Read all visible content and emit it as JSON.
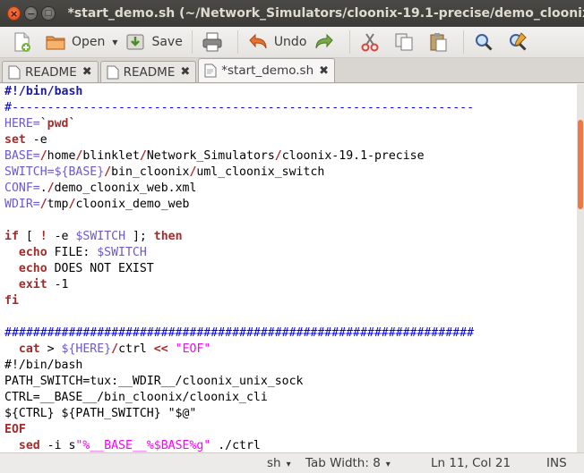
{
  "window": {
    "title": "*start_demo.sh (~/Network_Simulators/cloonix-19.1-precise/demo_cloonix_we",
    "close_glyph": "×",
    "min_glyph": "−",
    "max_glyph": "□"
  },
  "toolbar": {
    "open_label": "Open",
    "save_label": "Save",
    "undo_label": "Undo",
    "dropdown_glyph": "▾"
  },
  "tabs": [
    {
      "label": "README",
      "close": "✖"
    },
    {
      "label": "README",
      "close": "✖"
    },
    {
      "label": "*start_demo.sh",
      "close": "✖"
    }
  ],
  "editor": {
    "lines": [
      [
        {
          "t": "#!/bin/bash",
          "c": "sb"
        }
      ],
      [
        {
          "t": "#-----------------------------------------------------------------",
          "c": "cm"
        }
      ],
      [
        {
          "t": "HERE=",
          "c": "var"
        },
        {
          "t": "`",
          "c": ""
        },
        {
          "t": "pwd",
          "c": "cmd"
        },
        {
          "t": "`",
          "c": ""
        }
      ],
      [
        {
          "t": "set",
          "c": "kw"
        },
        {
          "t": " -e",
          "c": ""
        }
      ],
      [
        {
          "t": "BASE=",
          "c": "var"
        },
        {
          "t": "/",
          "c": "kw"
        },
        {
          "t": "home",
          "c": ""
        },
        {
          "t": "/",
          "c": "kw"
        },
        {
          "t": "blinklet",
          "c": ""
        },
        {
          "t": "/",
          "c": "kw"
        },
        {
          "t": "Network_Simulators",
          "c": ""
        },
        {
          "t": "/",
          "c": "kw"
        },
        {
          "t": "cloonix-19.1-precise",
          "c": ""
        }
      ],
      [
        {
          "t": "SWITCH=",
          "c": "var"
        },
        {
          "t": "${BASE}",
          "c": "var"
        },
        {
          "t": "/",
          "c": "kw"
        },
        {
          "t": "bin_cloonix",
          "c": ""
        },
        {
          "t": "/",
          "c": "kw"
        },
        {
          "t": "uml_cloonix_switch",
          "c": ""
        }
      ],
      [
        {
          "t": "CONF=",
          "c": "var"
        },
        {
          "t": ".",
          "c": ""
        },
        {
          "t": "/",
          "c": "kw"
        },
        {
          "t": "demo_cloonix_web.xml",
          "c": ""
        }
      ],
      [
        {
          "t": "WDIR=",
          "c": "var"
        },
        {
          "t": "/",
          "c": "kw"
        },
        {
          "t": "tmp",
          "c": ""
        },
        {
          "t": "/",
          "c": "kw"
        },
        {
          "t": "cloonix_demo_web",
          "c": ""
        }
      ],
      [],
      [
        {
          "t": "if",
          "c": "kw"
        },
        {
          "t": " [ ",
          "c": ""
        },
        {
          "t": "!",
          "c": "kw"
        },
        {
          "t": " -e ",
          "c": ""
        },
        {
          "t": "$SWITCH",
          "c": "var"
        },
        {
          "t": " ]; ",
          "c": ""
        },
        {
          "t": "then",
          "c": "kw"
        }
      ],
      [
        {
          "t": "  ",
          "c": ""
        },
        {
          "t": "echo",
          "c": "kw"
        },
        {
          "t": " FILE: ",
          "c": ""
        },
        {
          "t": "$SWITCH",
          "c": "var"
        }
      ],
      [
        {
          "t": "  ",
          "c": ""
        },
        {
          "t": "echo",
          "c": "kw"
        },
        {
          "t": " DOES NOT EXIST",
          "c": ""
        }
      ],
      [
        {
          "t": "  ",
          "c": ""
        },
        {
          "t": "exit",
          "c": "kw"
        },
        {
          "t": " -1",
          "c": ""
        }
      ],
      [
        {
          "t": "fi",
          "c": "kw"
        }
      ],
      [],
      [
        {
          "t": "##################################################################",
          "c": "cm"
        }
      ],
      [
        {
          "t": "  ",
          "c": ""
        },
        {
          "t": "cat",
          "c": "kw"
        },
        {
          "t": " > ",
          "c": ""
        },
        {
          "t": "${HERE}",
          "c": "var"
        },
        {
          "t": "/",
          "c": "kw"
        },
        {
          "t": "ctrl ",
          "c": ""
        },
        {
          "t": "<<",
          "c": "kw"
        },
        {
          "t": " ",
          "c": ""
        },
        {
          "t": "\"EOF\"",
          "c": "str"
        }
      ],
      [
        {
          "t": "#!/bin/bash",
          "c": ""
        }
      ],
      [
        {
          "t": "PATH_SWITCH=tux:__WDIR__/cloonix_unix_sock",
          "c": ""
        }
      ],
      [
        {
          "t": "CTRL=__BASE__/bin_cloonix/cloonix_cli",
          "c": ""
        }
      ],
      [
        {
          "t": "${CTRL} ${PATH_SWITCH} \"$@\"",
          "c": ""
        }
      ],
      [
        {
          "t": "EOF",
          "c": "kw"
        }
      ],
      [
        {
          "t": "  ",
          "c": ""
        },
        {
          "t": "sed",
          "c": "kw"
        },
        {
          "t": " -i s",
          "c": ""
        },
        {
          "t": "\"%__BASE__%$BASE%g\"",
          "c": "str"
        },
        {
          "t": " ./ctrl",
          "c": ""
        }
      ]
    ]
  },
  "status": {
    "language": "sh",
    "tab_width": "Tab Width: 8",
    "position": "Ln 11, Col 21",
    "mode": "INS",
    "dropdown_glyph": "▾"
  },
  "icons": [
    "new-document-icon",
    "open-folder-icon",
    "save-icon",
    "print-icon",
    "undo-icon",
    "redo-icon",
    "cut-icon",
    "copy-icon",
    "paste-icon",
    "find-icon",
    "find-replace-icon",
    "document-icon"
  ],
  "colors": {
    "accent": "#f07746",
    "close_button": "#df4a16",
    "title_bg": "#3c3b37"
  }
}
